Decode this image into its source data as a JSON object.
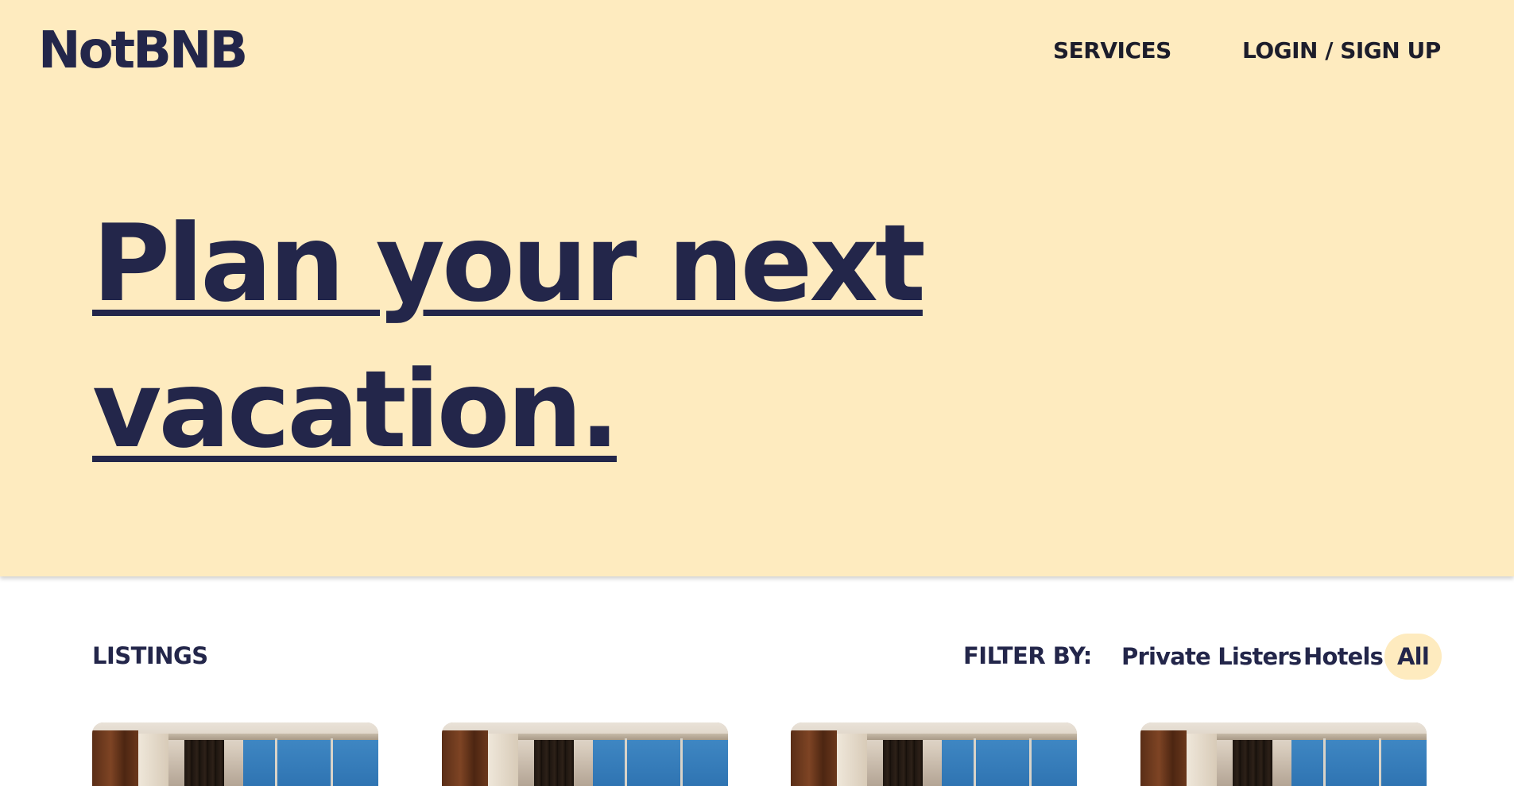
{
  "header": {
    "logo": "NotBNB",
    "nav": {
      "services": "SERVICES",
      "login": "LOGIN / SIGN UP"
    }
  },
  "hero": {
    "headline_line1": "Plan your next",
    "headline_line2": "vacation."
  },
  "listings": {
    "label": "LISTINGS",
    "filter_label": "FILTER BY:",
    "filters": [
      {
        "label": "Private Listers",
        "active": false
      },
      {
        "label": "Hotels",
        "active": false
      },
      {
        "label": "All",
        "active": true
      }
    ]
  },
  "colors": {
    "hero_bg": "#feebbf",
    "brand_navy": "#23264a",
    "active_filter_bg": "#feebbf"
  }
}
